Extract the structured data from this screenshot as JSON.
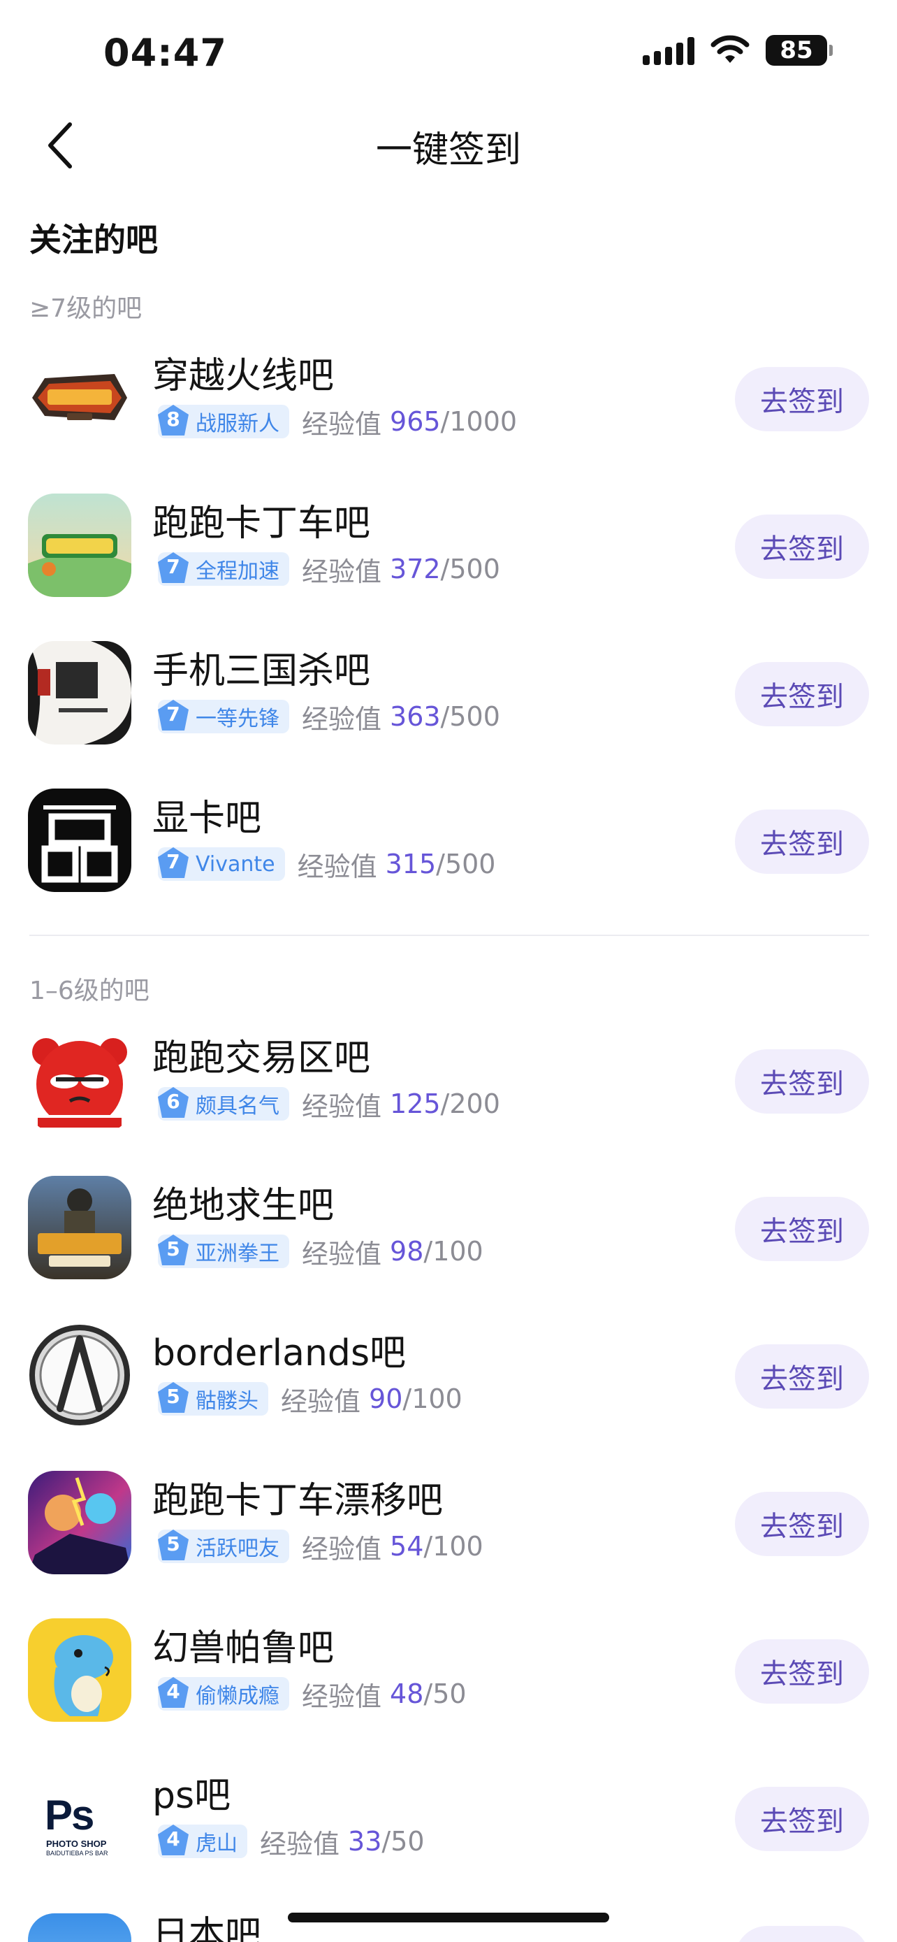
{
  "status_bar": {
    "time": "04:47",
    "battery": "85"
  },
  "nav": {
    "title": "一键签到"
  },
  "section_title": "关注的吧",
  "groups": [
    {
      "label": "≥7级的吧"
    },
    {
      "label": "1–6级的吧"
    }
  ],
  "exp_label": "经验值",
  "sign_label": "去签到",
  "bars": [
    {
      "name": "穿越火线吧",
      "level": "8",
      "level_title": "战服新人",
      "exp": "965",
      "exp_max": "1000",
      "avatar_icon": "crossfire-logo-icon"
    },
    {
      "name": "跑跑卡丁车吧",
      "level": "7",
      "level_title": "全程加速",
      "exp": "372",
      "exp_max": "500",
      "avatar_icon": "kartrider-logo-icon"
    },
    {
      "name": "手机三国杀吧",
      "level": "7",
      "level_title": "一等先锋",
      "exp": "363",
      "exp_max": "500",
      "avatar_icon": "sanguosha-logo-icon"
    },
    {
      "name": "显卡吧",
      "level": "7",
      "level_title": "Vivante",
      "exp": "315",
      "exp_max": "500",
      "avatar_icon": "gpu-bar-logo-icon"
    },
    {
      "name": "跑跑交易区吧",
      "level": "6",
      "level_title": "颇具名气",
      "exp": "125",
      "exp_max": "200",
      "avatar_icon": "red-mascot-icon"
    },
    {
      "name": "绝地求生吧",
      "level": "5",
      "level_title": "亚洲拳王",
      "exp": "98",
      "exp_max": "100",
      "avatar_icon": "pubg-logo-icon"
    },
    {
      "name": "borderlands吧",
      "level": "5",
      "level_title": "骷髅头",
      "exp": "90",
      "exp_max": "100",
      "avatar_icon": "borderlands-logo-icon"
    },
    {
      "name": "跑跑卡丁车漂移吧",
      "level": "5",
      "level_title": "活跃吧友",
      "exp": "54",
      "exp_max": "100",
      "avatar_icon": "kart-drift-art-icon"
    },
    {
      "name": "幻兽帕鲁吧",
      "level": "4",
      "level_title": "偷懒成瘾",
      "exp": "48",
      "exp_max": "50",
      "avatar_icon": "palworld-mascot-icon"
    },
    {
      "name": "ps吧",
      "level": "4",
      "level_title": "虎山",
      "exp": "33",
      "exp_max": "50",
      "avatar_icon": "photoshop-logo-icon",
      "avatar_text": "Ps",
      "avatar_sub": "PHOTO SHOP",
      "avatar_sub2": "BAIDUTIEBA PS BAR"
    },
    {
      "name": "日本吧",
      "avatar_icon": "japan-bar-logo-icon"
    }
  ],
  "colors": {
    "accent": "#6655d8",
    "button_bg": "#f1eefc",
    "badge_bg": "#e6f0fd",
    "badge_text": "#3f86e8"
  }
}
